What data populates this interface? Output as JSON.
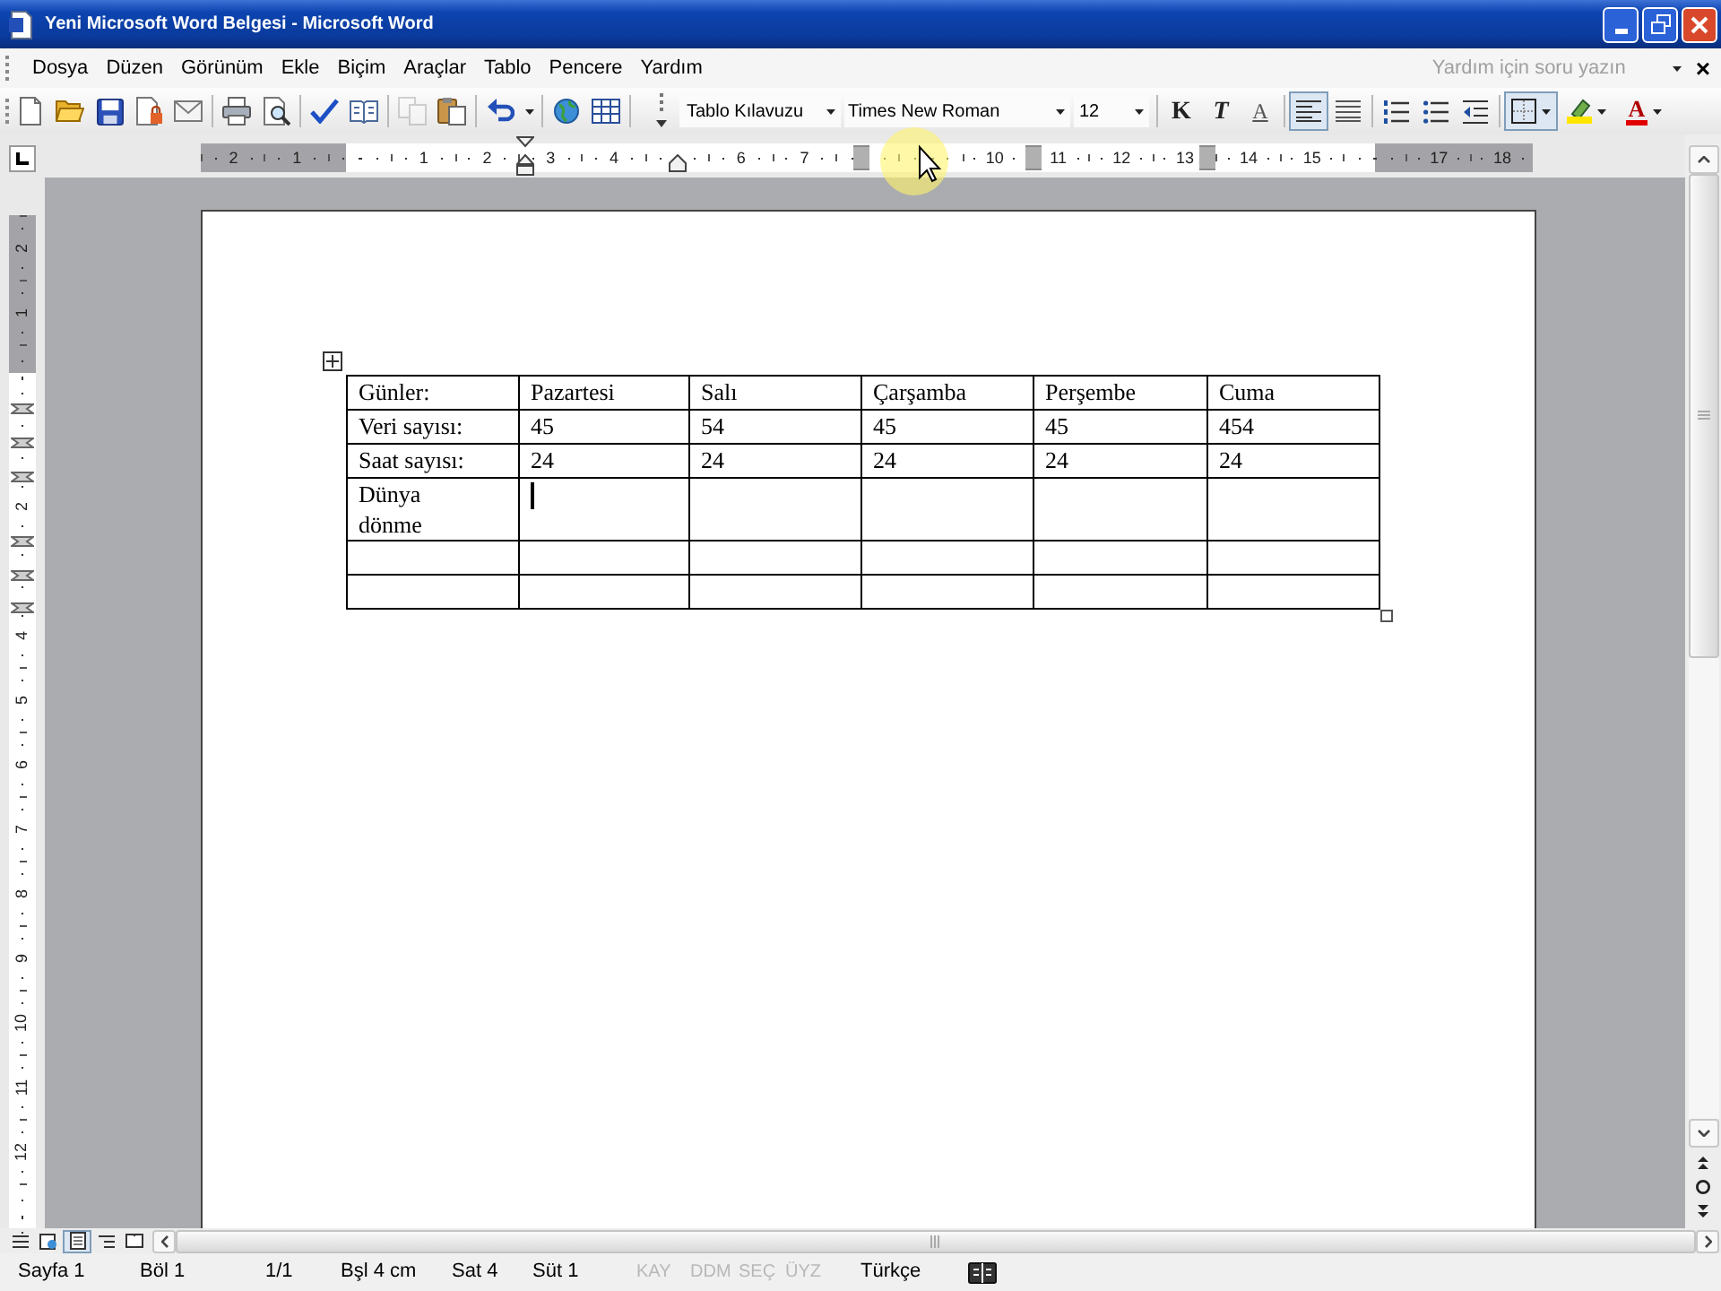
{
  "window": {
    "title": "Yeni Microsoft Word Belgesi - Microsoft Word"
  },
  "menu": {
    "items": [
      "Dosya",
      "Düzen",
      "Görünüm",
      "Ekle",
      "Biçim",
      "Araçlar",
      "Tablo",
      "Pencere",
      "Yardım"
    ],
    "help_box": {
      "placeholder": "Yardım için soru yazın"
    },
    "close_document": "×"
  },
  "standard_toolbar": [
    [
      {
        "kind": "new",
        "disabled": false
      },
      {
        "kind": "open",
        "disabled": false
      },
      {
        "kind": "save",
        "disabled": false
      },
      {
        "kind": "permission",
        "disabled": false
      },
      {
        "kind": "email",
        "disabled": false
      }
    ],
    [
      {
        "kind": "print",
        "disabled": false
      },
      {
        "kind": "preview",
        "disabled": false
      }
    ],
    [
      {
        "kind": "spelling",
        "disabled": false
      },
      {
        "kind": "research",
        "disabled": false
      }
    ],
    [
      {
        "kind": "copy",
        "disabled": true
      },
      {
        "kind": "paste",
        "disabled": false
      }
    ],
    [
      {
        "kind": "undo",
        "disabled": false
      }
    ],
    [
      {
        "kind": "hyperlink",
        "disabled": false
      },
      {
        "kind": "table",
        "disabled": false
      }
    ]
  ],
  "formatting_toolbar": {
    "style": "Tablo Kılavuzu",
    "font": "Times New Roman",
    "size": "12",
    "buttons": [
      [
        {
          "kind": "bold",
          "label": "K",
          "selected": false
        },
        {
          "kind": "italic",
          "label": "T",
          "selected": false
        },
        {
          "kind": "underline",
          "label": "A",
          "selected": false
        }
      ],
      [
        {
          "kind": "align_left",
          "selected": true
        },
        {
          "kind": "justify",
          "selected": false
        }
      ],
      [
        {
          "kind": "numbering",
          "selected": false
        },
        {
          "kind": "bullets",
          "selected": false
        },
        {
          "kind": "outdent",
          "selected": false
        }
      ],
      [
        {
          "kind": "borders",
          "selected": true
        },
        {
          "kind": "highlight",
          "selected": false
        },
        {
          "kind": "font_color",
          "label": "A",
          "selected": false
        }
      ]
    ]
  },
  "horizontal_ruler": [
    {
      "kind": "number",
      "label": "2"
    },
    {
      "kind": "number",
      "label": "1"
    },
    {
      "kind": "tick"
    },
    {
      "kind": "number",
      "label": "1"
    },
    {
      "kind": "number",
      "label": "2"
    },
    {
      "kind": "number",
      "label": "3"
    },
    {
      "kind": "number",
      "label": "4"
    },
    {
      "kind": "tick"
    },
    {
      "kind": "number",
      "label": "6"
    },
    {
      "kind": "number",
      "label": "7"
    },
    {
      "kind": "tick"
    },
    {
      "kind": "tick"
    },
    {
      "kind": "number",
      "label": "10"
    },
    {
      "kind": "number",
      "label": "11"
    },
    {
      "kind": "number",
      "label": "12"
    },
    {
      "kind": "number",
      "label": "13"
    },
    {
      "kind": "number",
      "label": "14"
    },
    {
      "kind": "number",
      "label": "15"
    },
    {
      "kind": "tick"
    },
    {
      "kind": "number",
      "label": "17"
    },
    {
      "kind": "number",
      "label": "18"
    }
  ],
  "vertical_ruler": [
    {
      "kind": "number",
      "label": "2"
    },
    {
      "kind": "number",
      "label": "1"
    },
    {
      "kind": "tick"
    },
    {
      "kind": "tick"
    },
    {
      "kind": "number",
      "label": "2"
    },
    {
      "kind": "tick"
    },
    {
      "kind": "number",
      "label": "4"
    },
    {
      "kind": "number",
      "label": "5"
    },
    {
      "kind": "number",
      "label": "6"
    },
    {
      "kind": "number",
      "label": "7"
    },
    {
      "kind": "number",
      "label": "8"
    },
    {
      "kind": "number",
      "label": "9"
    },
    {
      "kind": "number",
      "label": "10"
    },
    {
      "kind": "number",
      "label": "11"
    },
    {
      "kind": "number",
      "label": "12"
    },
    {
      "kind": "tick"
    }
  ],
  "table": {
    "rows": [
      {
        "cells": [
          {
            "kind": "text",
            "text": "Günler:"
          },
          {
            "kind": "text",
            "text": "Pazartesi"
          },
          {
            "kind": "text",
            "text": "Salı"
          },
          {
            "kind": "text",
            "text": "Çarşamba"
          },
          {
            "kind": "text",
            "text": "Perşembe"
          },
          {
            "kind": "text",
            "text": "Cuma"
          }
        ]
      },
      {
        "cells": [
          {
            "kind": "text",
            "text": "Veri sayısı:"
          },
          {
            "kind": "text",
            "text": "45"
          },
          {
            "kind": "text",
            "text": "54"
          },
          {
            "kind": "text",
            "text": "45"
          },
          {
            "kind": "text",
            "text": "45"
          },
          {
            "kind": "text",
            "text": "454"
          }
        ]
      },
      {
        "cells": [
          {
            "kind": "text",
            "text": "Saat sayısı:"
          },
          {
            "kind": "text",
            "text": "24"
          },
          {
            "kind": "text",
            "text": "24"
          },
          {
            "kind": "text",
            "text": "24"
          },
          {
            "kind": "text",
            "text": "24"
          },
          {
            "kind": "text",
            "text": "24"
          }
        ]
      },
      {
        "cells": [
          {
            "kind": "text",
            "text": "Dünya\ndönme"
          },
          {
            "kind": "caret"
          },
          {
            "kind": "empty"
          },
          {
            "kind": "empty"
          },
          {
            "kind": "empty"
          },
          {
            "kind": "empty"
          }
        ]
      },
      {
        "cells": [
          {
            "kind": "empty"
          },
          {
            "kind": "empty"
          },
          {
            "kind": "empty"
          },
          {
            "kind": "empty"
          },
          {
            "kind": "empty"
          },
          {
            "kind": "empty"
          }
        ]
      },
      {
        "cells": [
          {
            "kind": "empty"
          },
          {
            "kind": "empty"
          },
          {
            "kind": "empty"
          },
          {
            "kind": "empty"
          },
          {
            "kind": "empty"
          },
          {
            "kind": "empty"
          }
        ]
      }
    ]
  },
  "view_buttons": [
    {
      "kind": "normal",
      "selected": false
    },
    {
      "kind": "web",
      "selected": false
    },
    {
      "kind": "print",
      "selected": true
    },
    {
      "kind": "outline",
      "selected": false
    },
    {
      "kind": "reading",
      "selected": false
    }
  ],
  "status_bar": [
    {
      "text": "Sayfa 1",
      "disabled": false
    },
    {
      "text": "Böl 1",
      "disabled": false
    },
    {
      "text": "1/1",
      "disabled": false
    },
    {
      "text": "Bşl 4 cm",
      "disabled": false
    },
    {
      "text": "Sat 4",
      "disabled": false
    },
    {
      "text": "Süt 1",
      "disabled": false
    },
    {
      "text": "KAY",
      "disabled": true
    },
    {
      "text": "DDM",
      "disabled": true
    },
    {
      "text": "SEÇ",
      "disabled": true
    },
    {
      "text": "ÜYZ",
      "disabled": true
    },
    {
      "text": "Türkçe",
      "disabled": false
    }
  ]
}
